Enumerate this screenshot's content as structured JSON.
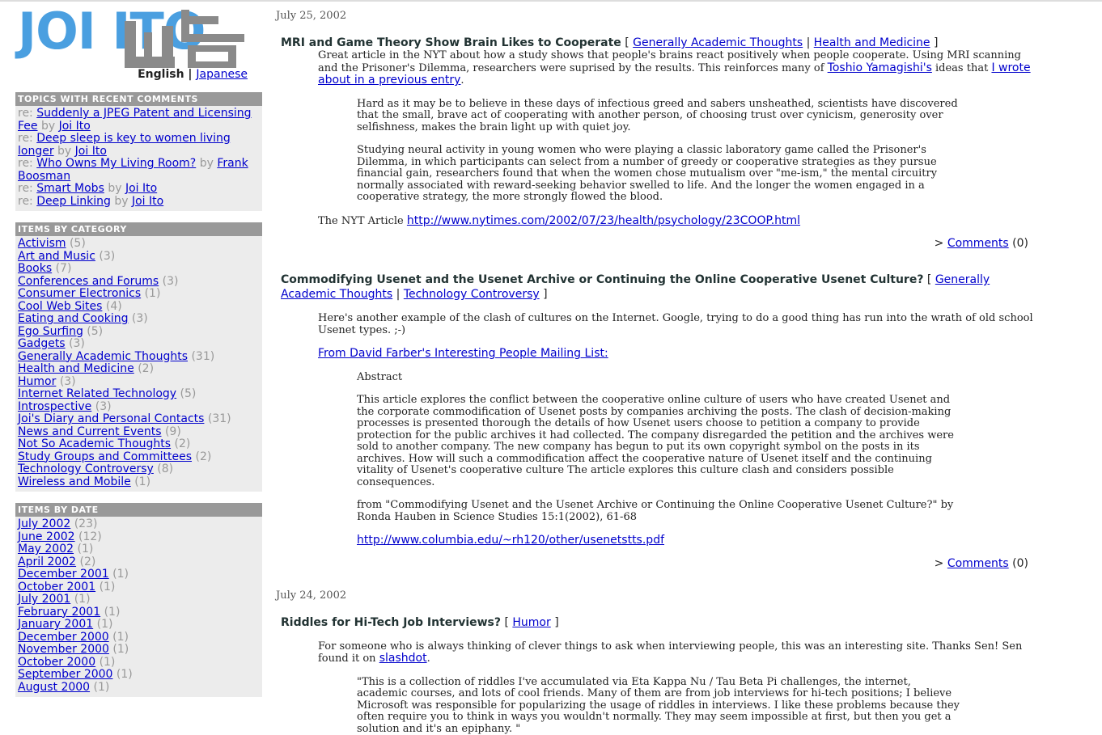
{
  "logo": {
    "latin": "JOI ITO",
    "kanji_alt": "伊藤"
  },
  "lang": {
    "current": "English",
    "sep": "|",
    "other": "Japanese"
  },
  "recent_comments": {
    "title": "TOPICS WITH RECENT COMMENTS",
    "items": [
      {
        "prefix": "re:",
        "topic": "Suddenly a JPEG Patent and Licensing Fee",
        "by": "by",
        "author": "Joi Ito"
      },
      {
        "prefix": "re:",
        "topic": "Deep sleep is key to women living longer",
        "by": "by",
        "author": "Joi Ito"
      },
      {
        "prefix": "re:",
        "topic": "Who Owns My Living Room?",
        "by": "by",
        "author": "Frank Boosman"
      },
      {
        "prefix": "re:",
        "topic": "Smart Mobs",
        "by": "by",
        "author": "Joi Ito"
      },
      {
        "prefix": "re:",
        "topic": "Deep Linking",
        "by": "by",
        "author": "Joi Ito"
      }
    ]
  },
  "categories": {
    "title": "ITEMS BY CATEGORY",
    "items": [
      {
        "name": "Activism",
        "count": "(5)"
      },
      {
        "name": "Art and Music",
        "count": "(3)"
      },
      {
        "name": "Books",
        "count": "(7)"
      },
      {
        "name": "Conferences and Forums",
        "count": "(3)"
      },
      {
        "name": "Consumer Electronics",
        "count": "(1)"
      },
      {
        "name": "Cool Web Sites",
        "count": "(4)"
      },
      {
        "name": "Eating and Cooking",
        "count": "(3)"
      },
      {
        "name": "Ego Surfing",
        "count": "(5)"
      },
      {
        "name": "Gadgets",
        "count": "(3)"
      },
      {
        "name": "Generally Academic Thoughts",
        "count": "(31)"
      },
      {
        "name": "Health and Medicine",
        "count": "(2)"
      },
      {
        "name": "Humor",
        "count": "(3)"
      },
      {
        "name": "Internet Related Technology",
        "count": "(5)"
      },
      {
        "name": "Introspective",
        "count": "(3)"
      },
      {
        "name": "Joi's Diary and Personal Contacts",
        "count": "(31)"
      },
      {
        "name": "News and Current Events",
        "count": "(9)"
      },
      {
        "name": "Not So Academic Thoughts",
        "count": "(2)"
      },
      {
        "name": "Study Groups and Committees",
        "count": "(2)"
      },
      {
        "name": "Technology Controversy",
        "count": "(8)"
      },
      {
        "name": "Wireless and Mobile",
        "count": "(1)"
      }
    ]
  },
  "dates": {
    "title": "ITEMS BY DATE",
    "items": [
      {
        "name": "July 2002",
        "count": "(23)"
      },
      {
        "name": "June 2002",
        "count": "(12)"
      },
      {
        "name": "May 2002",
        "count": "(1)"
      },
      {
        "name": "April 2002",
        "count": "(2)"
      },
      {
        "name": "December 2001",
        "count": "(1)"
      },
      {
        "name": "October 2001",
        "count": "(1)"
      },
      {
        "name": "July 2001",
        "count": "(1)"
      },
      {
        "name": "February 2001",
        "count": "(1)"
      },
      {
        "name": "January 2001",
        "count": "(1)"
      },
      {
        "name": "December 2000",
        "count": "(1)"
      },
      {
        "name": "November 2000",
        "count": "(1)"
      },
      {
        "name": "October 2000",
        "count": "(1)"
      },
      {
        "name": "September 2000",
        "count": "(1)"
      },
      {
        "name": "August 2000",
        "count": "(1)"
      }
    ]
  },
  "main": {
    "date1": "July 25, 2002",
    "post1": {
      "title": "MRI and Game Theory Show Brain Likes to Cooperate",
      "cat1": "Generally Academic Thoughts",
      "cat2": "Health and Medicine",
      "body_a": "Great article in the NYT about how a study shows that people's brains react positively when people cooperate. Using MRI scanning and the Prisoner's Dilemma, researchers were suprised by the results. This reinforces many of ",
      "link1": "Toshio Yamagishi's",
      "body_b": " ideas that ",
      "link2": "I wrote about in a previous entry",
      "body_c": ".",
      "quote1": "Hard as it may be to believe in these days of infectious greed and sabers unsheathed, scientists have discovered that the small, brave act of cooperating with another person, of choosing trust over cynicism, generosity over selfishness, makes the brain light up with quiet joy.",
      "quote2": "Studying neural activity in young women who were playing a classic laboratory game called the Prisoner's Dilemma, in which participants can select from a number of greedy or cooperative strategies as they pursue financial gain, researchers found that when the women chose mutualism over \"me-ism,\" the mental circuitry normally associated with reward-seeking behavior swelled to life. And the longer the women engaged in a cooperative strategy, the more strongly flowed the blood.",
      "nyt_label": "The NYT Article ",
      "nyt_url": "http://www.nytimes.com/2002/07/23/health/psychology/23COOP.html",
      "comments_prefix": "> ",
      "comments_label": "Comments",
      "comments_count": " (0)"
    },
    "post2": {
      "title": "Commodifying Usenet and the Usenet Archive or Continuing the Online Cooperative Usenet Culture?",
      "cat1": "Generally Academic Thoughts",
      "cat2": "Technology Controversy",
      "body": "Here's another example of the clash of cultures on the Internet. Google, trying to do a good thing has run into the wrath of old school Usenet types. ;-)",
      "source_link": "From David Farber's Interesting People Mailing List:",
      "abstract_head": "Abstract",
      "abstract": "This article explores the conflict between the cooperative online culture of users who have created Usenet and the corporate commodification of Usenet posts by companies archiving the posts. The clash of decision-making processes is presented thorough the details of how Usenet users choose to petition a company to provide protection for the public archives it had collected. The company disregarded the petition and the archives were sold to another company. The new company has begun to put its own copyright symbol on the posts in its archives. How will such a commodification affect the cooperative nature of Usenet itself and the continuing vitality of Usenet's cooperative culture The article explores this culture clash and considers possible consequences.",
      "citation": "from \"Commodifying Usenet and the Usenet Archive or Continuing the Online Cooperative Usenet Culture?\" by Ronda Hauben in Science Studies 15:1(2002), 61-68",
      "pdf_url": "http://www.columbia.edu/~rh120/other/usenetstts.pdf",
      "comments_prefix": "> ",
      "comments_label": "Comments",
      "comments_count": " (0)"
    },
    "date2": "July 24, 2002",
    "post3": {
      "title": "Riddles for Hi-Tech Job Interviews?",
      "cat1": "Humor",
      "body_a": "For someone who is always thinking of clever things to ask when interviewing people, this was an interesting site. Thanks Sen! Sen found it on ",
      "link1": "slashdot",
      "body_b": ".",
      "quote": "\"This is a collection of riddles I've accumulated via Eta Kappa Nu / Tau Beta Pi challenges, the internet, academic courses, and lots of cool friends. Many of them are from job interviews for hi-tech positions; I believe Microsoft was responsible for popularizing the usage of riddles in interviews. I like these problems because they often require you to think in ways you wouldn't normally. They may seem impossible at first, but then you get a solution and it's an epiphany. \""
    }
  }
}
